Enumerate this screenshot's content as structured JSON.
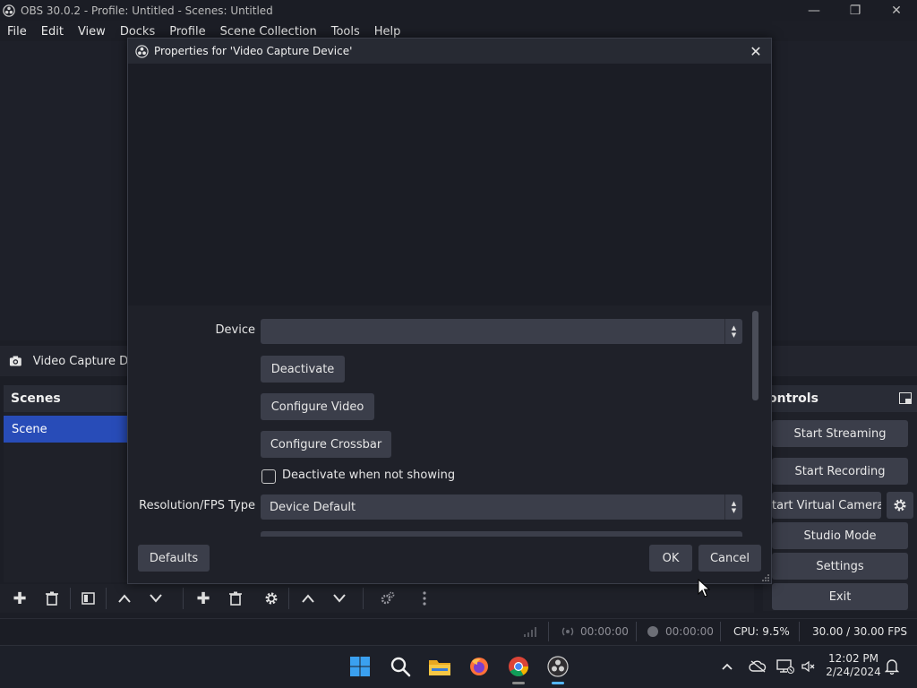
{
  "window": {
    "title": "OBS 30.0.2 - Profile: Untitled - Scenes: Untitled",
    "app_icon": "obs-logo-icon",
    "controls": [
      "minimize-icon",
      "restore-icon",
      "close-icon"
    ]
  },
  "menu": [
    "File",
    "Edit",
    "View",
    "Docks",
    "Profile",
    "Scene Collection",
    "Tools",
    "Help"
  ],
  "source_bar": {
    "label": "Video Capture De",
    "icon": "camera-icon"
  },
  "scenes": {
    "header": "Scenes",
    "items": [
      "Scene"
    ]
  },
  "controls": {
    "header": "ontrols",
    "buttons": {
      "start_streaming": "Start Streaming",
      "start_recording": "Start Recording",
      "virtual_camera": "tart Virtual Camera",
      "studio_mode": "Studio Mode",
      "settings": "Settings",
      "exit": "Exit"
    }
  },
  "statusbar": {
    "stream_time": "00:00:00",
    "record_time": "00:00:00",
    "cpu": "CPU: 9.5%",
    "fps": "30.00 / 30.00 FPS"
  },
  "dialog": {
    "title": "Properties for 'Video Capture Device'",
    "device_label": "Device",
    "device_value": "",
    "deactivate": "Deactivate",
    "configure_video": "Configure Video",
    "configure_crossbar": "Configure Crossbar",
    "deactivate_when_not_showing": "Deactivate when not showing",
    "resolution_label": "Resolution/FPS Type",
    "resolution_value": "Device Default",
    "defaults": "Defaults",
    "ok": "OK",
    "cancel": "Cancel"
  },
  "taskbar": {
    "apps": [
      "windows-start-icon",
      "search-icon",
      "file-explorer-icon",
      "firefox-icon",
      "chrome-icon",
      "obs-icon"
    ],
    "clock_time": "12:02 PM",
    "clock_date": "2/24/2024"
  },
  "colors": {
    "accent_blue": "#284cb8",
    "button": "#3b3e4a",
    "background": "#1f2129"
  }
}
